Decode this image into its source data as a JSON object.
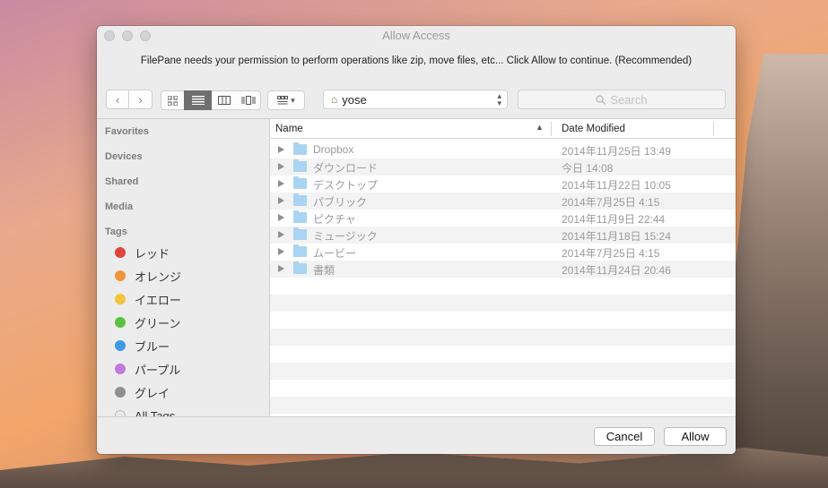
{
  "window": {
    "title": "Allow Access"
  },
  "message": "FilePane needs your permission to perform operations like zip, move files, etc... Click Allow to continue. (Recommended)",
  "toolbar": {
    "location": "yose",
    "search_placeholder": "Search"
  },
  "sidebar": {
    "sections": [
      "Favorites",
      "Devices",
      "Shared",
      "Media",
      "Tags"
    ],
    "tags": [
      {
        "label": "レッド",
        "color": "#e0443e"
      },
      {
        "label": "オレンジ",
        "color": "#f0953d"
      },
      {
        "label": "イエロー",
        "color": "#f2c53a"
      },
      {
        "label": "グリーン",
        "color": "#5ac142"
      },
      {
        "label": "ブルー",
        "color": "#3b9be8"
      },
      {
        "label": "パープル",
        "color": "#c07ad8"
      },
      {
        "label": "グレイ",
        "color": "#8f8f8f"
      },
      {
        "label": "All Tags…",
        "color": "#e8e8e8"
      }
    ]
  },
  "files": {
    "columns": {
      "name": "Name",
      "date": "Date Modified"
    },
    "rows": [
      {
        "name": "Dropbox",
        "date": "2014年11月25日 13:49"
      },
      {
        "name": "ダウンロード",
        "date": "今日 14:08"
      },
      {
        "name": "デスクトップ",
        "date": "2014年11月22日 10:05"
      },
      {
        "name": "パブリック",
        "date": "2014年7月25日 4:15"
      },
      {
        "name": "ピクチャ",
        "date": "2014年11月9日 22:44"
      },
      {
        "name": "ミュージック",
        "date": "2014年11月18日 15:24"
      },
      {
        "name": "ムービー",
        "date": "2014年7月25日 4:15"
      },
      {
        "name": "書類",
        "date": "2014年11月24日 20:46"
      }
    ]
  },
  "footer": {
    "cancel": "Cancel",
    "allow": "Allow"
  }
}
